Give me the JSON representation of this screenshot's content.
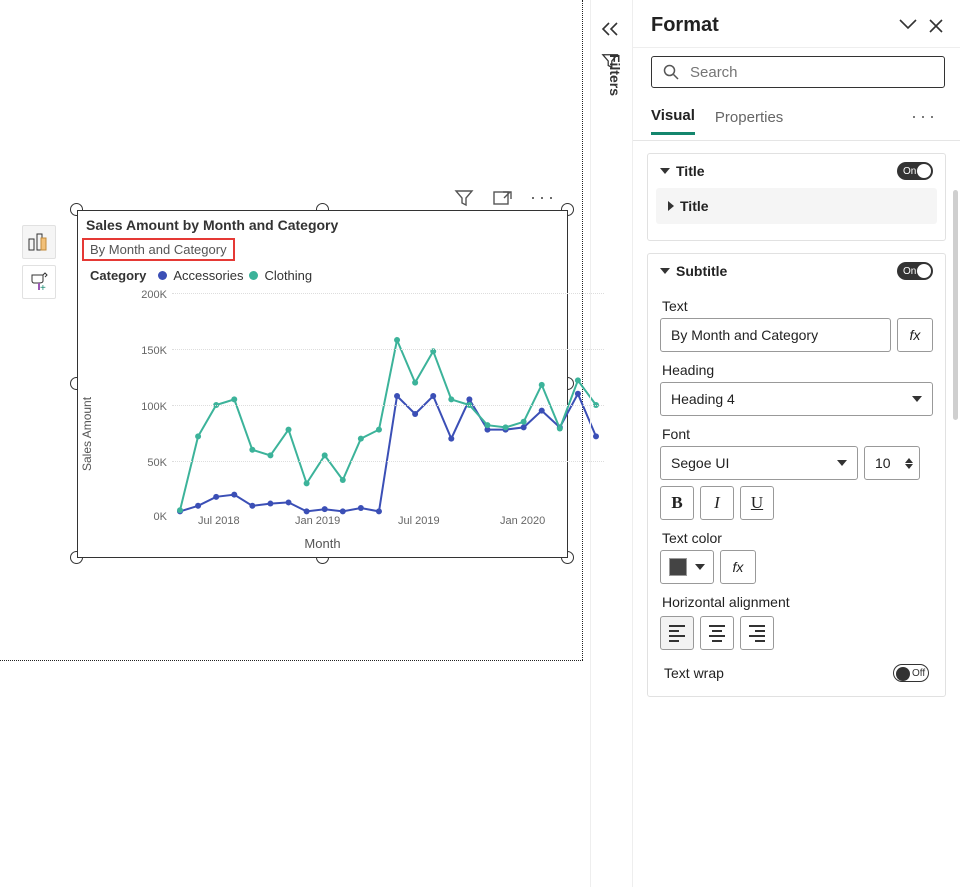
{
  "canvas": {
    "visual": {
      "title": "Sales Amount by Month and Category",
      "subtitle": "By Month and Category",
      "legend_label": "Category",
      "series": [
        {
          "name": "Accessories",
          "color": "#3B4FB6"
        },
        {
          "name": "Clothing",
          "color": "#3CB39A"
        }
      ],
      "y_axis_label": "Sales Amount",
      "x_axis_label": "Month",
      "y_ticks": [
        "200K",
        "150K",
        "100K",
        "50K",
        "0K"
      ],
      "x_ticks": [
        "Jul 2018",
        "Jan 2019",
        "Jul 2019",
        "Jan 2020"
      ]
    },
    "filters_strip_label": "Filters"
  },
  "format": {
    "pane_title": "Format",
    "search_placeholder": "Search",
    "tabs": {
      "visual": "Visual",
      "properties": "Properties"
    },
    "title_section": {
      "label": "Title",
      "inner_label": "Title",
      "toggle": "On"
    },
    "subtitle_section": {
      "label": "Subtitle",
      "toggle": "On",
      "text_label": "Text",
      "text_value": "By Month and Category",
      "fx_label": "fx",
      "heading_label": "Heading",
      "heading_value": "Heading 4",
      "font_label": "Font",
      "font_value": "Segoe UI",
      "font_size": "10",
      "bold": "B",
      "italic": "I",
      "underline": "U",
      "text_color_label": "Text color",
      "horiz_align_label": "Horizontal alignment",
      "text_wrap_label": "Text wrap",
      "text_wrap_toggle": "Off"
    }
  },
  "chart_data": {
    "type": "line",
    "title": "Sales Amount by Month and Category",
    "subtitle": "By Month and Category",
    "xlabel": "Month",
    "ylabel": "Sales Amount",
    "ylim": [
      0,
      200000
    ],
    "y_ticks": [
      0,
      50000,
      100000,
      150000,
      200000
    ],
    "x_ticks": [
      "Jul 2018",
      "Jan 2019",
      "Jul 2019",
      "Jan 2020"
    ],
    "categories": [
      "2018-07",
      "2018-08",
      "2018-09",
      "2018-10",
      "2018-11",
      "2018-12",
      "2019-01",
      "2019-02",
      "2019-03",
      "2019-04",
      "2019-05",
      "2019-06",
      "2019-07",
      "2019-08",
      "2019-09",
      "2019-10",
      "2019-11",
      "2019-12",
      "2020-01",
      "2020-02",
      "2020-03",
      "2020-04",
      "2020-05",
      "2020-06"
    ],
    "series": [
      {
        "name": "Accessories",
        "color": "#3B4FB6",
        "values": [
          5000,
          10000,
          18000,
          20000,
          10000,
          12000,
          13000,
          5000,
          7000,
          5000,
          8000,
          5000,
          108000,
          92000,
          108000,
          70000,
          105000,
          78000,
          78000,
          80000,
          95000,
          80000,
          110000,
          72000
        ]
      },
      {
        "name": "Clothing",
        "color": "#3CB39A",
        "values": [
          6000,
          72000,
          100000,
          105000,
          60000,
          55000,
          78000,
          30000,
          55000,
          33000,
          70000,
          78000,
          158000,
          120000,
          148000,
          105000,
          100000,
          82000,
          80000,
          85000,
          118000,
          79000,
          122000,
          100000
        ]
      }
    ]
  }
}
